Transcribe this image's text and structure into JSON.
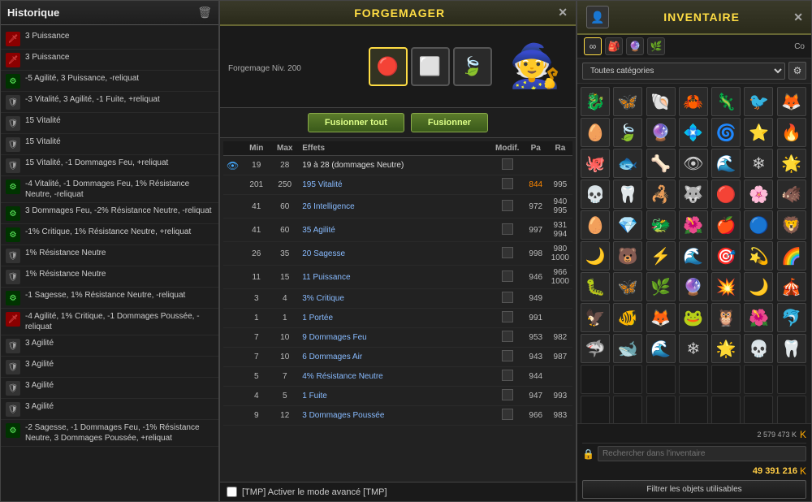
{
  "historique": {
    "title": "Historique",
    "items": [
      {
        "icon": "red",
        "text": "3 Puissance",
        "symbol": "🗡"
      },
      {
        "icon": "red",
        "text": "3 Puissance",
        "symbol": "🗡"
      },
      {
        "icon": "green",
        "text": "-5 Agilité, 3 Puissance, -reliquat",
        "symbol": "⚙"
      },
      {
        "icon": "gray",
        "text": "-3 Vitalité, 3 Agilité, -1 Fuite, +reliquat",
        "symbol": "🛡"
      },
      {
        "icon": "gray",
        "text": "15 Vitalité",
        "symbol": "🛡"
      },
      {
        "icon": "gray",
        "text": "15 Vitalité",
        "symbol": "🛡"
      },
      {
        "icon": "gray",
        "text": "15 Vitalité, -1 Dommages Feu, +reliquat",
        "symbol": "🛡"
      },
      {
        "icon": "green",
        "text": "-4 Vitalité, -1 Dommages Feu, 1% Résistance Neutre, -reliquat",
        "symbol": "⚙"
      },
      {
        "icon": "green",
        "text": "3 Dommages Feu, -2% Résistance Neutre, -reliquat",
        "symbol": "⚙"
      },
      {
        "icon": "green",
        "text": "-1% Critique, 1% Résistance Neutre, +reliquat",
        "symbol": "⚙"
      },
      {
        "icon": "gray",
        "text": "1% Résistance Neutre",
        "symbol": "🛡"
      },
      {
        "icon": "gray",
        "text": "1% Résistance Neutre",
        "symbol": "🛡"
      },
      {
        "icon": "green",
        "text": "-1 Sagesse, 1% Résistance Neutre, -reliquat",
        "symbol": "⚙"
      },
      {
        "icon": "red",
        "text": "-4 Agilité, 1% Critique, -1 Dommages Poussée, -reliquat",
        "symbol": "🗡"
      },
      {
        "icon": "gray",
        "text": "3 Agilité",
        "symbol": "🛡"
      },
      {
        "icon": "gray",
        "text": "3 Agilité",
        "symbol": "🛡"
      },
      {
        "icon": "gray",
        "text": "3 Agilité",
        "symbol": "🛡"
      },
      {
        "icon": "gray",
        "text": "3 Agilité",
        "symbol": "🛡"
      },
      {
        "icon": "green",
        "text": "-2 Sagesse, -1 Dommages Feu, -1% Résistance Neutre, 3 Dommages Poussée, +reliquat",
        "symbol": "⚙"
      }
    ]
  },
  "forgemager": {
    "title": "FORGEMAGER",
    "level_text": "Forgemage Niv. 200",
    "slot1": "🔴",
    "slot2": "⬜",
    "slot3": "🍃",
    "btn_all": "Fusionner tout",
    "btn_one": "Fusionner",
    "columns": {
      "min": "Min",
      "max": "Max",
      "effet": "Effets",
      "modif": "Modif.",
      "pa": "Pa",
      "ra": "Ra"
    },
    "rows": [
      {
        "eye": true,
        "min": "19",
        "max": "28",
        "effet": "19 à 28 (dommages Neutre)",
        "effect_class": "white",
        "modif": "",
        "pa": "",
        "ra": ""
      },
      {
        "eye": false,
        "min": "201",
        "max": "250",
        "effet": "195 Vitalité",
        "effect_class": "blue",
        "modif": "",
        "pa": "844",
        "ra": "995",
        "pa_class": "orange"
      },
      {
        "eye": false,
        "min": "41",
        "max": "60",
        "effet": "26 Intelligence",
        "effect_class": "blue",
        "modif": "",
        "pa": "972",
        "ra": "940",
        "ra2": "995"
      },
      {
        "eye": false,
        "min": "41",
        "max": "60",
        "effet": "35 Agilité",
        "effect_class": "blue",
        "modif": "",
        "pa": "997",
        "ra": "931",
        "ra2": "994"
      },
      {
        "eye": false,
        "min": "26",
        "max": "35",
        "effet": "20 Sagesse",
        "effect_class": "blue",
        "modif": "",
        "pa": "998",
        "ra": "980",
        "ra2": "1000"
      },
      {
        "eye": false,
        "min": "11",
        "max": "15",
        "effet": "11 Puissance",
        "effect_class": "blue",
        "modif": "",
        "pa": "946",
        "ra": "966",
        "ra2": "1000"
      },
      {
        "eye": false,
        "min": "3",
        "max": "4",
        "effet": "3% Critique",
        "effect_class": "blue",
        "modif": "",
        "pa": "949",
        "ra": "",
        "ra2": ""
      },
      {
        "eye": false,
        "min": "1",
        "max": "1",
        "effet": "1 Portée",
        "effect_class": "blue",
        "modif": "",
        "pa": "991",
        "ra": "",
        "ra2": ""
      },
      {
        "eye": false,
        "min": "7",
        "max": "10",
        "effet": "9 Dommages Feu",
        "effect_class": "blue",
        "modif": "",
        "pa": "953",
        "ra": "982",
        "ra2": ""
      },
      {
        "eye": false,
        "min": "7",
        "max": "10",
        "effet": "6 Dommages Air",
        "effect_class": "blue",
        "modif": "",
        "pa": "943",
        "ra": "987",
        "ra2": ""
      },
      {
        "eye": false,
        "min": "5",
        "max": "7",
        "effet": "4% Résistance Neutre",
        "effect_class": "blue",
        "modif": "",
        "pa": "944",
        "ra": "",
        "ra2": ""
      },
      {
        "eye": false,
        "min": "4",
        "max": "5",
        "effet": "1 Fuite",
        "effect_class": "blue",
        "modif": "",
        "pa": "947",
        "ra": "993",
        "ra2": ""
      },
      {
        "eye": false,
        "min": "9",
        "max": "12",
        "effet": "3 Dommages Poussée",
        "effect_class": "blue",
        "modif": "",
        "pa": "966",
        "ra": "983",
        "ra2": ""
      }
    ],
    "footer_checkbox": "[TMP] Activer le mode avancé [TMP]"
  },
  "inventaire": {
    "title": "INVENTAIRE",
    "category": "Toutes catégories",
    "currency1": "2 579 473 K",
    "currency2": "49 391 216",
    "search_placeholder": "Rechercher dans l'inventaire",
    "filter_btn": "Filtrer les objets utilisables",
    "top_icons": [
      "∞",
      "🎒",
      "🔮",
      "🌿"
    ],
    "items": [
      "🐉",
      "🦋",
      "🐚",
      "🦀",
      "🦎",
      "🐦",
      "🦊",
      "🥚",
      "🍃",
      "🔮",
      "💠",
      "🌀",
      "⭐",
      "🔥",
      "🐙",
      "🐟",
      "🦴",
      "👁",
      "🌊",
      "❄",
      "🌟",
      "💀",
      "🦷",
      "🦂",
      "🐺",
      "🔴",
      "🌸",
      "🐗",
      "🥚",
      "💎",
      "🐲",
      "🌺",
      "🍎",
      "🔵",
      "🦁",
      "🌙",
      "🐻",
      "⚡",
      "🌊",
      "🎯",
      "💫",
      "🌈",
      "🐛",
      "🦋",
      "🌿",
      "🔮",
      "💥",
      "🌙",
      "🎪",
      "🦅",
      "🐠",
      "🦊",
      "🐸",
      "🦉",
      "🌺",
      "🐬",
      "🦈",
      "🐋",
      "🌊",
      "❄",
      "🌟",
      "💀",
      "🦷",
      "",
      "",
      "",
      "",
      "",
      "",
      "",
      "",
      "",
      "",
      "",
      "",
      "",
      ""
    ]
  }
}
